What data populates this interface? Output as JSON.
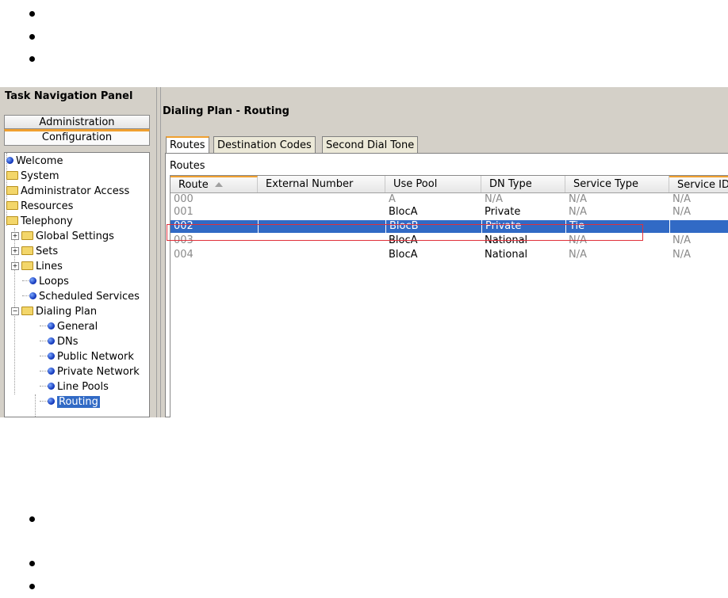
{
  "nav": {
    "panel_title": "Task Navigation Panel",
    "admin_label": "Administration",
    "config_label": "Configuration",
    "tree": [
      {
        "label": "Welcome",
        "icon": "dot-icon"
      },
      {
        "label": "System",
        "icon": "folder-icon"
      },
      {
        "label": "Administrator Access",
        "icon": "folder-icon"
      },
      {
        "label": "Resources",
        "icon": "folder-icon"
      },
      {
        "label": "Telephony",
        "icon": "folder-icon"
      },
      {
        "label": "Global Settings",
        "icon": "folder-icon"
      },
      {
        "label": "Sets",
        "icon": "folder-icon"
      },
      {
        "label": "Lines",
        "icon": "folder-icon"
      },
      {
        "label": "Loops",
        "icon": "dot-icon"
      },
      {
        "label": "Scheduled Services",
        "icon": "dot-icon"
      },
      {
        "label": "Dialing Plan",
        "icon": "folder-icon"
      },
      {
        "label": "General",
        "icon": "dot-icon"
      },
      {
        "label": "DNs",
        "icon": "dot-icon"
      },
      {
        "label": "Public Network",
        "icon": "dot-icon"
      },
      {
        "label": "Private Network",
        "icon": "dot-icon"
      },
      {
        "label": "Line Pools",
        "icon": "dot-icon"
      },
      {
        "label": "Routing",
        "icon": "dot-icon",
        "selected": true
      }
    ]
  },
  "main": {
    "title": "Dialing Plan - Routing",
    "tabs": [
      "Routes",
      "Destination Codes",
      "Second Dial Tone"
    ],
    "section_label": "Routes",
    "columns": [
      "Route",
      "External Number",
      "Use Pool",
      "DN Type",
      "Service Type",
      "Service ID"
    ],
    "rows": [
      {
        "route": "000",
        "external": "",
        "pool": "A",
        "dn_type": "N/A",
        "service_type": "N/A",
        "service_id": "N/A"
      },
      {
        "route": "001",
        "external": "",
        "pool": "BlocA",
        "dn_type": "Private",
        "service_type": "N/A",
        "service_id": "N/A"
      },
      {
        "route": "002",
        "external": "",
        "pool": "BlocB",
        "dn_type": "Private",
        "service_type": "Tie",
        "service_id": ""
      },
      {
        "route": "003",
        "external": "",
        "pool": "BlocA",
        "dn_type": "National",
        "service_type": "N/A",
        "service_id": "N/A"
      },
      {
        "route": "004",
        "external": "",
        "pool": "BlocA",
        "dn_type": "National",
        "service_type": "N/A",
        "service_id": "N/A"
      }
    ]
  },
  "colors": {
    "selection": "#316ac5",
    "accent_tab": "#f0a030",
    "highlight_box": "#e0303a"
  }
}
